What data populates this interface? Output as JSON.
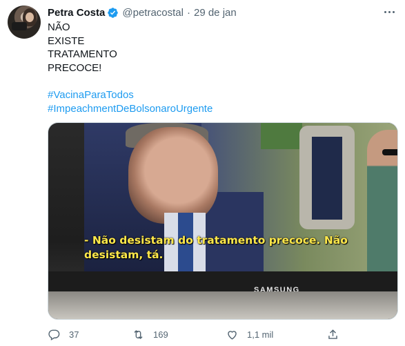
{
  "tweet": {
    "author_name": "Petra Costa",
    "handle": "@petracostal",
    "separator": "·",
    "date": "29 de jan",
    "lines": [
      "NÃO",
      "EXISTE",
      "TRATAMENTO",
      "PRECOCE!"
    ],
    "hashtags": [
      "#VacinaParaTodos",
      "#ImpeachmentDeBolsonaroUrgente"
    ],
    "media": {
      "subtitle_line1": "- Não desistam do tratamento precoce. Não",
      "subtitle_line2": "desistam, tá.",
      "tv_brand": "SAMSUNG"
    },
    "actions": {
      "reply_count": "37",
      "retweet_count": "169",
      "like_count": "1,1 mil"
    }
  },
  "colors": {
    "link": "#1d9bf0",
    "secondary_text": "#536471",
    "verified": "#1d9bf0",
    "subtitle": "#ffe84a"
  },
  "icons": [
    "verified-badge-icon",
    "more-icon",
    "reply-icon",
    "retweet-icon",
    "like-icon",
    "share-icon"
  ]
}
